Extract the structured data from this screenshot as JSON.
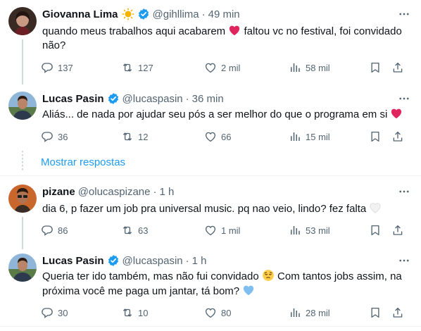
{
  "tweets": [
    {
      "name": "Giovanna Lima",
      "handle": "@gihllima",
      "dot": "·",
      "time": "49 min",
      "text_a": "quando meus trabalhos aqui acabarem",
      "text_b": "faltou vc no festival, foi convidado não?",
      "replies": "137",
      "retweets": "127",
      "likes": "2 mil",
      "views": "58 mil"
    },
    {
      "name": "Lucas Pasin",
      "handle": "@lucaspasin",
      "dot": "·",
      "time": "36 min",
      "text_a": "Aliás... de nada por ajudar seu pós a ser melhor do que o programa em si",
      "replies": "36",
      "retweets": "12",
      "likes": "66",
      "views": "15 mil"
    },
    {
      "name": "pizane",
      "handle": "@olucaspizane",
      "dot": "·",
      "time": "1 h",
      "text_a": "dia 6, p fazer um job pra universal music. pq nao veio, lindo? fez falta",
      "replies": "86",
      "retweets": "63",
      "likes": "1 mil",
      "views": "53 mil"
    },
    {
      "name": "Lucas Pasin",
      "handle": "@lucaspasin",
      "dot": "·",
      "time": "1 h",
      "text_a": "Queria ter ido também, mas não fui convidado",
      "text_b": "Com tantos jobs assim, na próxima você me paga um jantar, tá bom?",
      "replies": "30",
      "retweets": "10",
      "likes": "80",
      "views": "28 mil"
    }
  ],
  "show_replies": "Mostrar respostas",
  "colors": {
    "accent": "#1d9bf0",
    "muted": "#536471",
    "text": "#0f1419",
    "verified": "#1d9bf0"
  },
  "icons": [
    "reply-icon",
    "retweet-icon",
    "like-icon",
    "views-icon",
    "bookmark-icon",
    "share-icon",
    "more-icon",
    "verified-badge-icon",
    "sun-emoji",
    "red-heart-emoji",
    "white-heart-emoji",
    "pensive-face-emoji",
    "blue-heart-emoji"
  ]
}
